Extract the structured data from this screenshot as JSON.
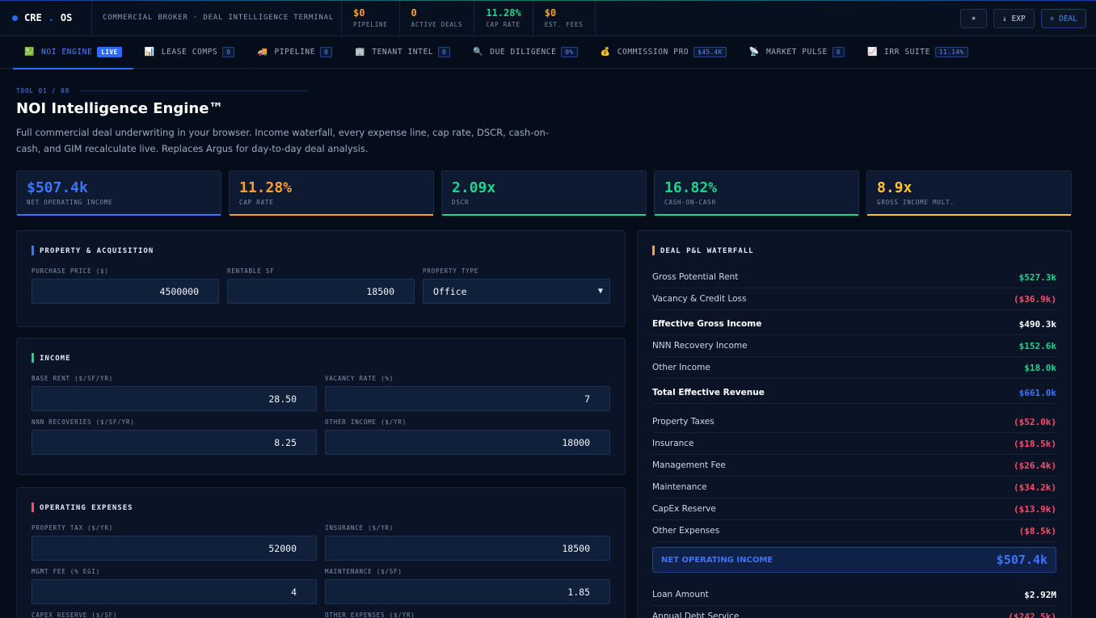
{
  "topbar": {
    "brand_left": "CRE",
    "brand_sep": ".",
    "brand_right": "OS",
    "tagline": "COMMERCIAL BROKER · DEAL INTELLIGENCE TERMINAL",
    "stats": [
      {
        "value": "$0",
        "label": "PIPELINE",
        "color": "#ff9f2e"
      },
      {
        "value": "0",
        "label": "ACTIVE DEALS",
        "color": "#ff9f2e"
      },
      {
        "value": "11.28%",
        "label": "CAP RATE",
        "color": "#22d38f"
      },
      {
        "value": "$0",
        "label": "EST. FEES",
        "color": "#ff9f2e"
      }
    ],
    "buttons": {
      "theme": "☀",
      "export": "↓ EXP",
      "deal": "+ DEAL"
    }
  },
  "tabs": [
    {
      "icon": "💹",
      "label": "NOI ENGINE",
      "badge": "LIVE"
    },
    {
      "icon": "📊",
      "label": "LEASE COMPS",
      "badge": "0"
    },
    {
      "icon": "🚚",
      "label": "PIPELINE",
      "badge": "0"
    },
    {
      "icon": "🏢",
      "label": "TENANT INTEL",
      "badge": "0"
    },
    {
      "icon": "🔍",
      "label": "DUE DILIGENCE",
      "badge": "0%"
    },
    {
      "icon": "💰",
      "label": "COMMISSION PRO",
      "badge": "$45.4K"
    },
    {
      "icon": "📡",
      "label": "MARKET PULSE",
      "badge": "0"
    },
    {
      "icon": "📈",
      "label": "IRR SUITE",
      "badge": "11.14%"
    }
  ],
  "header": {
    "tool_no": "TOOL 01 / 08",
    "title": "NOI Intelligence Engine™",
    "description": "Full commercial deal underwriting in your browser. Income waterfall, every expense line, cap rate, DSCR, cash-on-cash, and GIM recalculate live. Replaces Argus for day-to-day deal analysis."
  },
  "kpis": [
    {
      "value": "$507.4k",
      "label": "NET OPERATING INCOME",
      "color": "#3d74ff"
    },
    {
      "value": "11.28%",
      "label": "CAP RATE",
      "color": "#ff9f2e"
    },
    {
      "value": "2.09x",
      "label": "DSCR",
      "color": "#22d38f"
    },
    {
      "value": "16.82%",
      "label": "CASH-ON-CASH",
      "color": "#22d38f"
    },
    {
      "value": "8.9x",
      "label": "GROSS INCOME MULT.",
      "color": "#ffc233"
    }
  ],
  "property": {
    "title": "PROPERTY & ACQUISITION",
    "purchase_price": {
      "label": "PURCHASE PRICE ($)",
      "value": "4500000"
    },
    "rentable_sf": {
      "label": "RENTABLE SF",
      "value": "18500"
    },
    "property_type": {
      "label": "PROPERTY TYPE",
      "value": "Office"
    }
  },
  "income": {
    "title": "INCOME",
    "base_rent": {
      "label": "BASE RENT ($/SF/YR)",
      "value": "28.50"
    },
    "vacancy_rate": {
      "label": "VACANCY RATE (%)",
      "value": "7"
    },
    "nnn_recoveries": {
      "label": "NNN RECOVERIES ($/SF/YR)",
      "value": "8.25"
    },
    "other_income": {
      "label": "OTHER INCOME ($/YR)",
      "value": "18000"
    }
  },
  "opex": {
    "title": "OPERATING EXPENSES",
    "property_tax": {
      "label": "PROPERTY TAX ($/YR)",
      "value": "52000"
    },
    "insurance": {
      "label": "INSURANCE ($/YR)",
      "value": "18500"
    },
    "mgmt_fee": {
      "label": "MGMT FEE (% EGI)",
      "value": "4"
    },
    "maintenance": {
      "label": "MAINTENANCE ($/SF)",
      "value": "1.85"
    },
    "capex_reserve": {
      "label": "CAPEX RESERVE ($/SF)"
    },
    "other_expenses": {
      "label": "OTHER EXPENSES ($/YR)"
    }
  },
  "waterfall": {
    "title": "DEAL P&L WATERFALL",
    "rows": [
      {
        "name": "Gross Potential Rent",
        "amount": "$527.3k",
        "tone": "green",
        "bold": false
      },
      {
        "name": "Vacancy & Credit Loss",
        "amount": "($36.9k)",
        "tone": "red",
        "bold": false
      },
      {
        "name": "Effective Gross Income",
        "amount": "$490.3k",
        "tone": "white",
        "bold": true
      },
      {
        "name": "NNN Recovery Income",
        "amount": "$152.6k",
        "tone": "green",
        "bold": false
      },
      {
        "name": "Other Income",
        "amount": "$18.0k",
        "tone": "green",
        "bold": false
      },
      {
        "name": "Total Effective Revenue",
        "amount": "$661.0k",
        "tone": "blue",
        "bold": true
      },
      {
        "name": "Property Taxes",
        "amount": "($52.0k)",
        "tone": "red",
        "bold": false
      },
      {
        "name": "Insurance",
        "amount": "($18.5k)",
        "tone": "red",
        "bold": false
      },
      {
        "name": "Management Fee",
        "amount": "($26.4k)",
        "tone": "red",
        "bold": false
      },
      {
        "name": "Maintenance",
        "amount": "($34.2k)",
        "tone": "red",
        "bold": false
      },
      {
        "name": "CapEx Reserve",
        "amount": "($13.9k)",
        "tone": "red",
        "bold": false
      },
      {
        "name": "Other Expenses",
        "amount": "($8.5k)",
        "tone": "red",
        "bold": false
      }
    ],
    "noi": {
      "name": "NET OPERATING INCOME",
      "amount": "$507.4k"
    },
    "after": [
      {
        "name": "Loan Amount",
        "amount": "$2.92M",
        "tone": "white",
        "bold": false
      },
      {
        "name": "Annual Debt Service",
        "amount": "($242.5k)",
        "tone": "red",
        "bold": false
      }
    ]
  }
}
